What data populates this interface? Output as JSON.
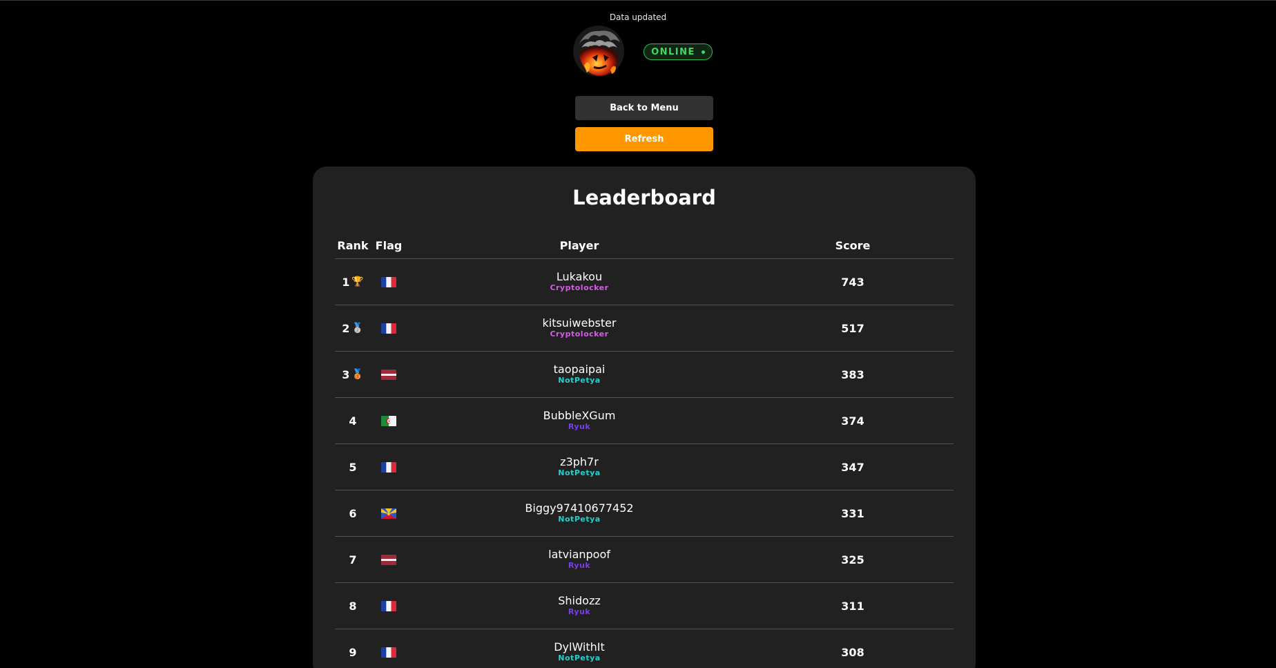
{
  "status": {
    "text": "Data updated",
    "online_label": "ONLINE",
    "online_color": "#42d85f"
  },
  "buttons": {
    "back_label": "Back to Menu",
    "refresh_label": "Refresh",
    "refresh_color": "#ff9800"
  },
  "leaderboard": {
    "title": "Leaderboard",
    "headers": {
      "rank": "Rank",
      "flag": "Flag",
      "player": "Player",
      "score": "Score"
    },
    "team_colors": {
      "Cryptolocker": "#d65ce8",
      "NotPetya": "#1fd2cf",
      "Ryuk": "#7b3fe8"
    },
    "rows": [
      {
        "rank": "1",
        "medal": "🏆",
        "medal_icon": "trophy-icon",
        "flag": "france",
        "player": "Lukakou",
        "team": "Cryptolocker",
        "score": "743"
      },
      {
        "rank": "2",
        "medal": "🥈",
        "medal_icon": "silver-medal-icon",
        "flag": "france",
        "player": "kitsuiwebster",
        "team": "Cryptolocker",
        "score": "517"
      },
      {
        "rank": "3",
        "medal": "🥉",
        "medal_icon": "bronze-medal-icon",
        "flag": "latvia",
        "player": "taopaipai",
        "team": "NotPetya",
        "score": "383"
      },
      {
        "rank": "4",
        "medal": "",
        "medal_icon": "",
        "flag": "algeria",
        "player": "BubbleXGum",
        "team": "Ryuk",
        "score": "374"
      },
      {
        "rank": "5",
        "medal": "",
        "medal_icon": "",
        "flag": "france",
        "player": "z3ph7r",
        "team": "NotPetya",
        "score": "347"
      },
      {
        "rank": "6",
        "medal": "",
        "medal_icon": "",
        "flag": "reunion",
        "player": "Biggy97410677452",
        "team": "NotPetya",
        "score": "331"
      },
      {
        "rank": "7",
        "medal": "",
        "medal_icon": "",
        "flag": "latvia",
        "player": "latvianpoof",
        "team": "Ryuk",
        "score": "325"
      },
      {
        "rank": "8",
        "medal": "",
        "medal_icon": "",
        "flag": "france",
        "player": "Shidozz",
        "team": "Ryuk",
        "score": "311"
      },
      {
        "rank": "9",
        "medal": "",
        "medal_icon": "",
        "flag": "france",
        "player": "DylWithIt",
        "team": "NotPetya",
        "score": "308"
      }
    ]
  }
}
